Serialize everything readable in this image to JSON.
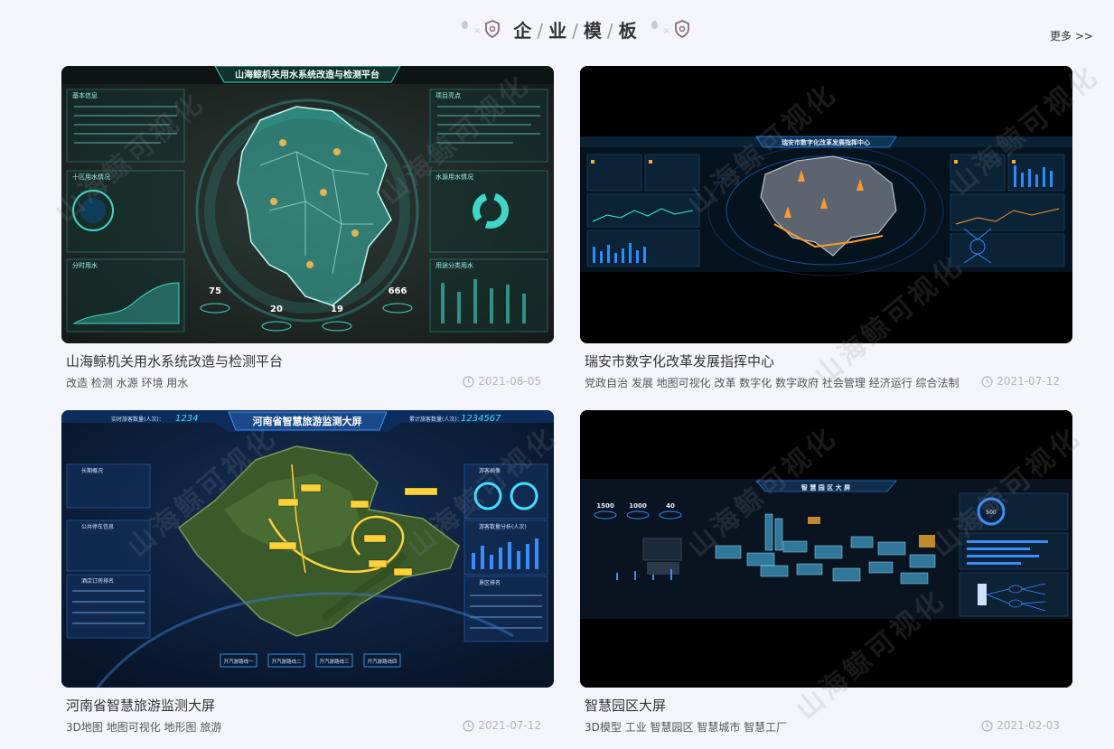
{
  "section": {
    "title_chars": [
      "企",
      "业",
      "模",
      "板"
    ],
    "more_label": "更多 >>"
  },
  "cards": [
    {
      "title": "山海鲸机关用水系统改造与检测平台",
      "tags": "改造 检测 水源 环境 用水",
      "date": "2021-08-05",
      "thumb": {
        "heading": "山海鲸机关用水系统改造与检测平台",
        "panels": [
          "基本信息",
          "十区用水情况",
          "分时用水",
          "项目亮点",
          "水源用水情况",
          "用途分类用水"
        ],
        "stats": [
          "75",
          "20",
          "19",
          "666"
        ]
      }
    },
    {
      "title": "瑞安市数字化改革发展指挥中心",
      "tags": "党政自治 发展 地图可视化 改革 数字化 数字政府 社会管理 经济运行 综合法制",
      "date": "2021-07-12",
      "thumb": {
        "heading": "瑞安市数字化改革发展指挥中心"
      }
    },
    {
      "title": "河南省智慧旅游监测大屏",
      "tags": "3D地图 地图可视化 地形图 旅游",
      "date": "2021-07-12",
      "thumb": {
        "heading": "河南省智慧旅游监测大屏",
        "left_label": "实时旅客数量(人次)：",
        "left_value": "1234",
        "right_label": "累计旅客数量(人次)：",
        "right_value": "1234567",
        "panels": [
          "长期概况",
          "公共停车信息",
          "酒店订房排名",
          "游客画像",
          "游客数量分析(人次)",
          "景区排名"
        ],
        "buttons": [
          "开汽游路线一",
          "开汽游路线二",
          "开汽游路线三",
          "开汽游路线四"
        ]
      }
    },
    {
      "title": "智慧园区大屏",
      "tags": "3D模型 工业 智慧园区 智慧城市 智慧工厂",
      "date": "2021-02-03",
      "thumb": {
        "heading": "智 慧 园 区 大 屏",
        "stats": [
          "1500",
          "1000",
          "40"
        ],
        "right_value": "500"
      }
    }
  ],
  "watermark_text": "山海鲸可视化",
  "colors": {
    "accent_teal": "#3fd7c8",
    "accent_blue": "#2a8cff",
    "text_dark": "#333333",
    "text_muted": "#b0b4bf",
    "page_bg": "#f4f5fb"
  }
}
